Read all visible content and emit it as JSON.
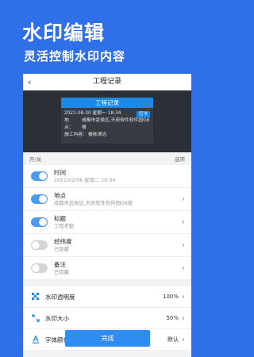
{
  "promo": {
    "title": "水印编辑",
    "subtitle": "灵活控制水印内容"
  },
  "nav": {
    "back_icon": "chevron-left-icon",
    "title": "工程记录"
  },
  "watermark": {
    "title": "工程记录",
    "datetime": "2021-08-30 星期一 18:34",
    "badge": "打卡",
    "address_key": "地　点：",
    "address_value": "成都市武侯区,天府软件软件园G6楼",
    "content_key": "施工内容：",
    "content_value": "楼栋清洁"
  },
  "section": {
    "left": "开/关",
    "right": "选项"
  },
  "fields": [
    {
      "label": "时间",
      "value": "2021/02/06 星期二 10:34",
      "on": true,
      "chevron": false
    },
    {
      "label": "地点",
      "value": "成都市武侯区,天府软件软件园G6楼",
      "on": true,
      "chevron": true
    },
    {
      "label": "标题",
      "value": "工程考勤",
      "on": true,
      "chevron": true
    },
    {
      "label": "经纬度",
      "value": "已隐藏",
      "on": false,
      "chevron": true
    },
    {
      "label": "备注",
      "value": "已隐藏",
      "on": false,
      "chevron": true
    }
  ],
  "settings": [
    {
      "label": "水印透明度",
      "value": "100%",
      "icon": "checkerboard-icon"
    },
    {
      "label": "水印大小",
      "value": "50%",
      "icon": "resize-icon"
    },
    {
      "label": "字体颜色",
      "value": "默认",
      "icon": "font-color-icon"
    }
  ],
  "done_label": "完成",
  "colors": {
    "brand_blue": "#2f6fe8",
    "accent": "#1e88e5",
    "toggle_on": "#4b9cf0"
  }
}
